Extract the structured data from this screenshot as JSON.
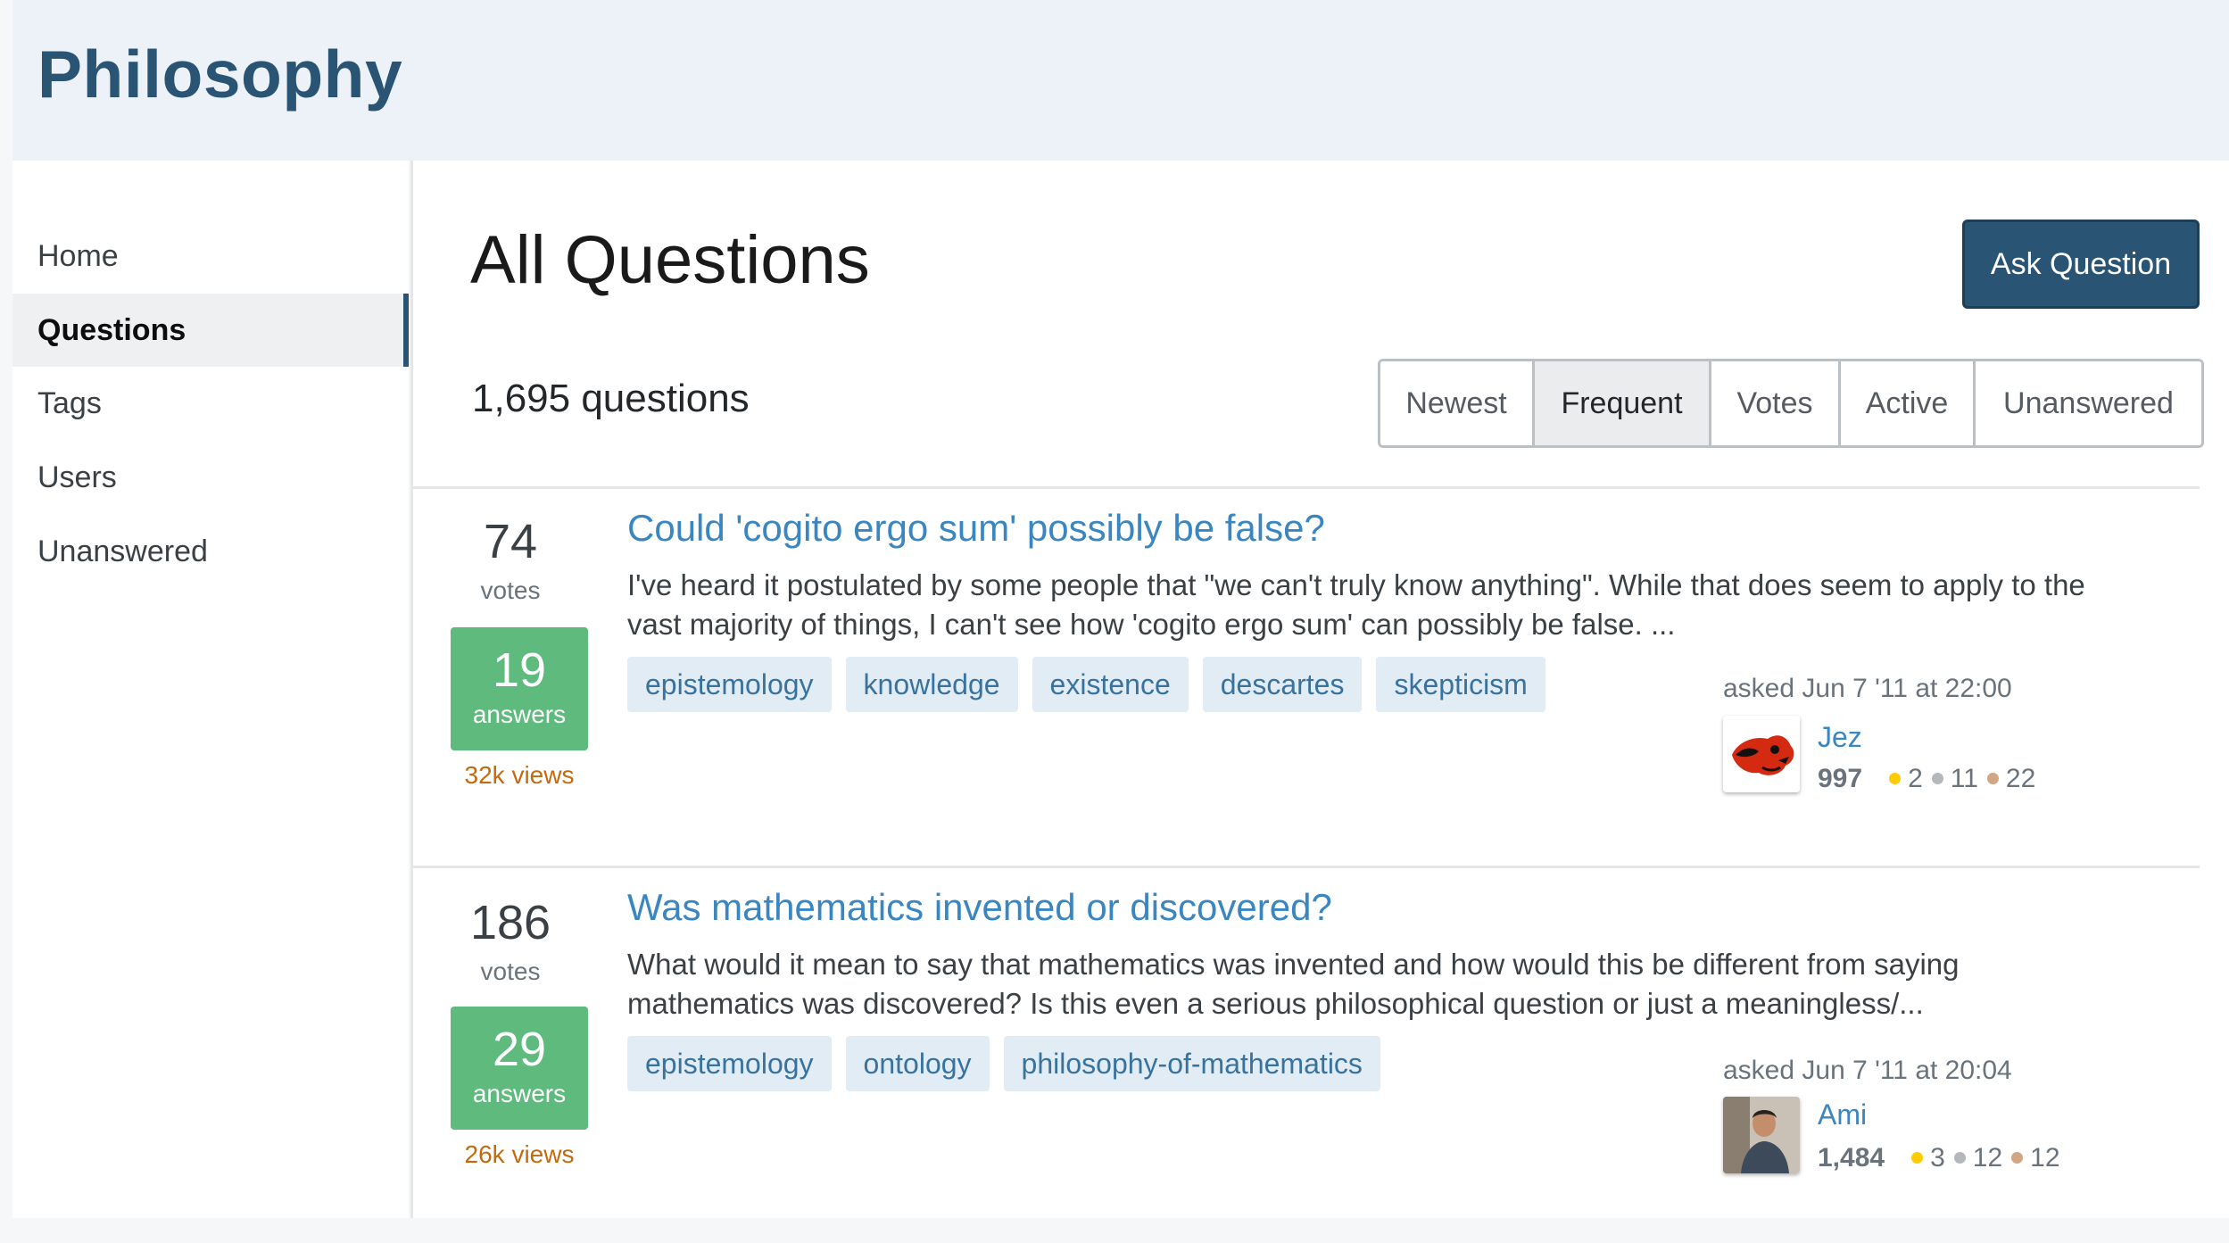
{
  "site": {
    "title": "Philosophy"
  },
  "nav": {
    "items": [
      {
        "label": "Home"
      },
      {
        "label": "Questions"
      },
      {
        "label": "Tags"
      },
      {
        "label": "Users"
      },
      {
        "label": "Unanswered"
      }
    ],
    "active": "Questions"
  },
  "page": {
    "heading": "All Questions",
    "ask_button": "Ask Question",
    "count": "1,695 questions",
    "tabs": [
      "Newest",
      "Frequent",
      "Votes",
      "Active",
      "Unanswered"
    ],
    "active_tab": "Frequent"
  },
  "questions": [
    {
      "votes": "74",
      "votes_label": "votes",
      "answers": "19",
      "answers_label": "answers",
      "views": "32k views",
      "title": "Could 'cogito ergo sum' possibly be false?",
      "excerpt_line1": "I've heard it postulated by some people that \"we can't truly know anything\". While that does seem to apply to the",
      "excerpt_line2": "vast majority of things, I can't see how 'cogito ergo sum' can possibly be false. ...",
      "tags": [
        "epistemology",
        "knowledge",
        "existence",
        "descartes",
        "skepticism"
      ],
      "asked": "asked Jun 7 '11 at 22:00",
      "user": "Jez",
      "rep": "997",
      "gold": "2",
      "silver": "11",
      "bronze": "22",
      "avatar_icon": "red-fox-avatar-icon"
    },
    {
      "votes": "186",
      "votes_label": "votes",
      "answers": "29",
      "answers_label": "answers",
      "views": "26k views",
      "title": "Was mathematics invented or discovered?",
      "excerpt_line1": "What would it mean to say that mathematics was invented and how would this be different from saying",
      "excerpt_line2": "mathematics was discovered? Is this even a serious philosophical question or just a meaningless/...",
      "tags": [
        "epistemology",
        "ontology",
        "philosophy-of-mathematics"
      ],
      "asked": "asked Jun 7 '11 at 20:04",
      "user": "Ami",
      "rep": "1,484",
      "gold": "3",
      "silver": "12",
      "bronze": "12",
      "avatar_icon": "user-photo-avatar-icon"
    }
  ],
  "colors": {
    "brand": "#2a5474",
    "link": "#3a86c0",
    "answered": "#5eba7d",
    "views": "#c36a0e",
    "tag_bg": "#e1ecf4",
    "tag_text": "#39739d",
    "gold": "#ffcc01",
    "silver": "#b4b8bc",
    "bronze": "#d1a684"
  }
}
